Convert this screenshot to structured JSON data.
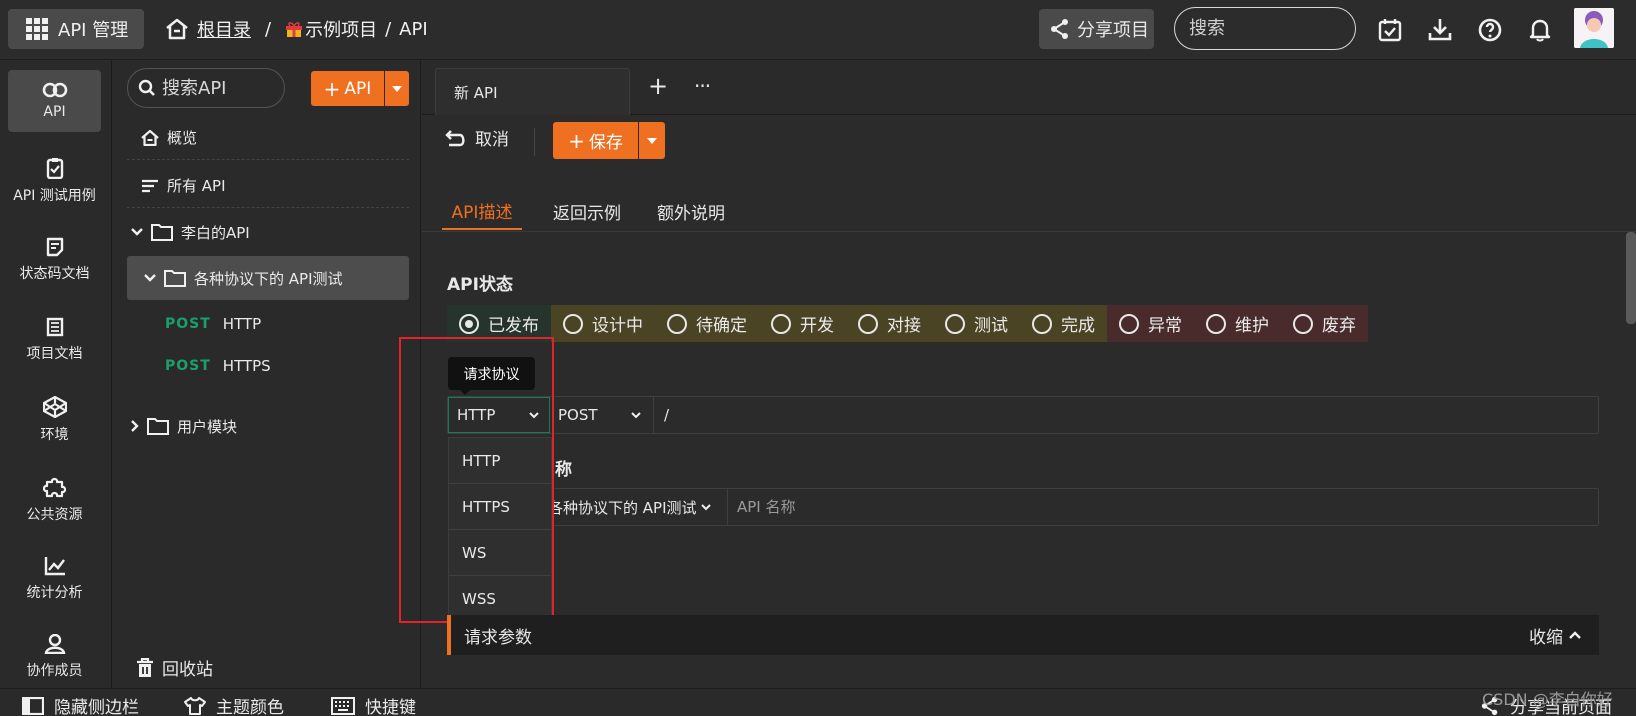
{
  "header": {
    "app_title": "API 管理",
    "breadcrumb": {
      "root": "根目录",
      "sep1": "/",
      "project": "示例项目",
      "sep2": "/",
      "current": "API"
    },
    "share_label": "分享项目",
    "search_placeholder": "搜索"
  },
  "nav": [
    {
      "label": "API",
      "icon": "link-icon"
    },
    {
      "label": "API 测试用例",
      "icon": "clipboard-check-icon"
    },
    {
      "label": "状态码文档",
      "icon": "doc-icon"
    },
    {
      "label": "项目文档",
      "icon": "book-icon"
    },
    {
      "label": "环境",
      "icon": "codepen-icon"
    },
    {
      "label": "公共资源",
      "icon": "puzzle-icon"
    },
    {
      "label": "统计分析",
      "icon": "chart-icon"
    },
    {
      "label": "协作成员",
      "icon": "user-icon"
    }
  ],
  "sidebar": {
    "search_placeholder": "搜索API",
    "add_label": "API",
    "overview": "概览",
    "all_api": "所有 API",
    "group1": "李白的API",
    "group1_child": "各种协议下的 API测试",
    "apis": [
      {
        "method": "POST",
        "name": "HTTP"
      },
      {
        "method": "POST",
        "name": "HTTPS"
      }
    ],
    "group2": "用户模块",
    "recycle": "回收站"
  },
  "tabs": {
    "new_api": "新 API",
    "add": "+",
    "more": "···"
  },
  "toolbar": {
    "cancel": "取消",
    "save": "保存"
  },
  "subtabs": [
    "API描述",
    "返回示例",
    "额外说明"
  ],
  "status": {
    "title": "API状态",
    "options": [
      {
        "label": "已发布",
        "group": "green",
        "selected": true
      },
      {
        "label": "设计中",
        "group": "olive"
      },
      {
        "label": "待确定",
        "group": "olive"
      },
      {
        "label": "开发",
        "group": "olive"
      },
      {
        "label": "对接",
        "group": "olive"
      },
      {
        "label": "测试",
        "group": "olive"
      },
      {
        "label": "完成",
        "group": "olive"
      },
      {
        "label": "异常",
        "group": "maroon"
      },
      {
        "label": "维护",
        "group": "maroon"
      },
      {
        "label": "废弃",
        "group": "maroon"
      }
    ],
    "colors": {
      "green": "#26342e",
      "olive": "#4a4425",
      "maroon": "#4a2b2c"
    }
  },
  "request": {
    "tooltip": "请求协议",
    "protocol": "HTTP",
    "method": "POST",
    "url": "/",
    "protocol_options": [
      "HTTP",
      "HTTPS",
      "WS",
      "WSS"
    ]
  },
  "api_name": {
    "label_visible": "称",
    "folder": "各种协议下的 API测试",
    "placeholder": "API 名称"
  },
  "params": {
    "title": "请求参数",
    "collapse": "收缩"
  },
  "bottom": {
    "hide_sidebar": "隐藏侧边栏",
    "theme": "主题颜色",
    "shortcuts": "快捷键",
    "share_page": "分享当前页面"
  },
  "watermark": "CSDN @李白你好",
  "colors": {
    "accent": "#f07021",
    "method_post": "#1aa06d",
    "highlight_box": "#e2242a"
  }
}
